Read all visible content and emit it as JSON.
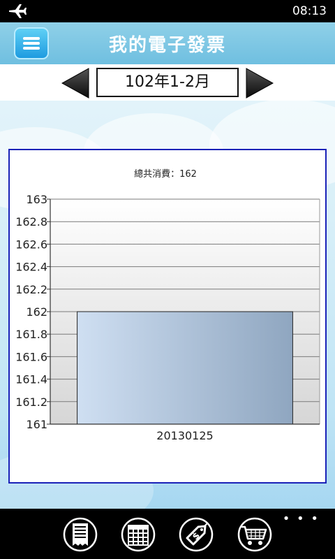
{
  "status_bar": {
    "time": "08:13",
    "airplane_icon": "airplane-icon"
  },
  "header": {
    "title": "我的電子發票",
    "menu_icon": "hamburger-menu-icon"
  },
  "period_selector": {
    "label": "102年1-2月",
    "prev_icon": "triangle-left-icon",
    "next_icon": "triangle-right-icon"
  },
  "chart_data": {
    "type": "bar",
    "title": "總共消費：162",
    "categories": [
      "20130125"
    ],
    "values": [
      162
    ],
    "ylim": [
      161,
      163
    ],
    "yticks": [
      "161",
      "161.2",
      "161.4",
      "161.6",
      "161.8",
      "162",
      "162.2",
      "162.4",
      "162.6",
      "162.8",
      "163"
    ],
    "grid": true,
    "legend": "none",
    "colors": {
      "bar_light": "#cfdff2",
      "bar_dark": "#8fa6c0",
      "grid": "#7a7a7a"
    }
  },
  "app_bar": {
    "ellipsis": "• • •",
    "buttons": [
      {
        "name": "invoice-receipt-button",
        "icon": "receipt-icon"
      },
      {
        "name": "calendar-button",
        "icon": "calendar-icon"
      },
      {
        "name": "price-tag-button",
        "icon": "dollar-tag-icon"
      },
      {
        "name": "shopping-cart-button",
        "icon": "shopping-cart-icon"
      }
    ]
  },
  "colors": {
    "header_bg": "#7cc6e4",
    "menu_button": "#1e9be0",
    "panel_border": "#1a22b8"
  }
}
